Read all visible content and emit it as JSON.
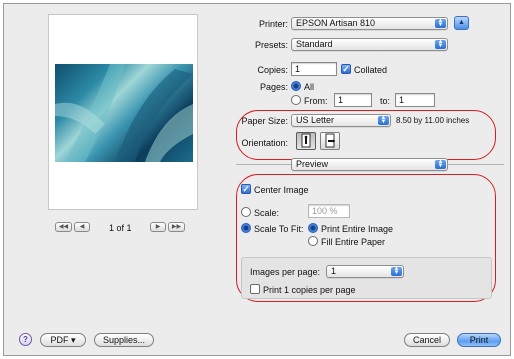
{
  "printer": {
    "label": "Printer:",
    "value": "EPSON Artisan 810"
  },
  "presets": {
    "label": "Presets:",
    "value": "Standard"
  },
  "copies": {
    "label": "Copies:",
    "value": "1",
    "collated_label": "Collated"
  },
  "pages": {
    "label": "Pages:",
    "all_label": "All",
    "from_label": "From:",
    "from_value": "1",
    "to_label": "to:",
    "to_value": "1"
  },
  "paper_size": {
    "label": "Paper Size:",
    "value": "US Letter",
    "dimensions": "8.50 by 11.00 inches"
  },
  "orientation": {
    "label": "Orientation:"
  },
  "section_popup": {
    "value": "Preview"
  },
  "preview": {
    "page_indicator": "1 of 1"
  },
  "options": {
    "center_image_label": "Center Image",
    "scale_label": "Scale:",
    "scale_value": "100 %",
    "scale_to_fit_label": "Scale To Fit:",
    "print_entire_image_label": "Print Entire Image",
    "fill_entire_paper_label": "Fill Entire Paper"
  },
  "images": {
    "label": "Images per page:",
    "value": "1",
    "print_copies_label": "Print 1 copies per page"
  },
  "footer": {
    "help_label": "?",
    "pdf_label": "PDF ▾",
    "supplies_label": "Supplies...",
    "cancel_label": "Cancel",
    "print_label": "Print"
  },
  "colors": {
    "accent": "#2e6ed2",
    "annotation": "#d91e1e"
  }
}
